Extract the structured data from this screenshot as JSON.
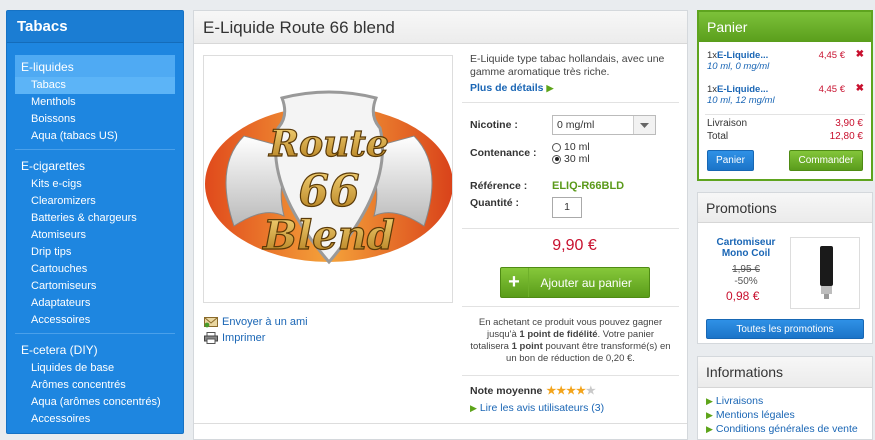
{
  "sidebar": {
    "title": "Tabacs",
    "groups": [
      {
        "label": "E-liquides",
        "items": [
          "Tabacs",
          "Menthols",
          "Boissons",
          "Aqua (tabacs US)"
        ]
      },
      {
        "label": "E-cigarettes",
        "items": [
          "Kits e-cigs",
          "Clearomizers",
          "Batteries & chargeurs",
          "Atomiseurs",
          "Drip tips",
          "Cartouches",
          "Cartomiseurs",
          "Adaptateurs",
          "Accessoires"
        ]
      },
      {
        "label": "E-cetera (DIY)",
        "items": [
          "Liquides de base",
          "Arômes concentrés",
          "Aqua (arômes concentrés)",
          "Accessoires"
        ]
      }
    ]
  },
  "product": {
    "title": "E-Liquide Route 66 blend",
    "image_text": {
      "top": "Route",
      "mid": "66",
      "bottom": "Blend"
    },
    "description": "E-Liquide type tabac hollandais, avec une gamme aromatique très riche.",
    "more_details": "Plus de détails",
    "nicotine_label": "Nicotine :",
    "nicotine_value": "0 mg/ml",
    "contenance_label": "Contenance :",
    "contenance_options": [
      "10 ml",
      "30 ml"
    ],
    "reference_label": "Référence :",
    "reference_value": "ELIQ-R66BLD",
    "quantity_label": "Quantité :",
    "quantity_value": "1",
    "price": "9,90 €",
    "add_to_cart": "Ajouter au panier",
    "loyalty_pre": "En achetant ce produit vous pouvez gagner jusqu'à",
    "loyalty_points1": "1 point de fidélité",
    "loyalty_mid": ". Votre panier totalisera",
    "loyalty_points2": "1 point",
    "loyalty_post": "pouvant être transformé(s) en un bon de réduction de 0,20 €.",
    "rating_label": "Note moyenne",
    "rating": 4,
    "rating_max": 5,
    "reviews_link": "Lire les avis utilisateurs (3)",
    "send_friend": "Envoyer à un ami",
    "print": "Imprimer"
  },
  "cart": {
    "title": "Panier",
    "items": [
      {
        "qty": "1x",
        "name": "E-Liquide...",
        "variant": "10 ml, 0 mg/ml",
        "price": "4,45 €"
      },
      {
        "qty": "1x",
        "name": "E-Liquide...",
        "variant": "10 ml, 12 mg/ml",
        "price": "4,45 €"
      }
    ],
    "shipping_label": "Livraison",
    "shipping_value": "3,90 €",
    "total_label": "Total",
    "total_value": "12,80 €",
    "cart_button": "Panier",
    "order_button": "Commander"
  },
  "promotions": {
    "title": "Promotions",
    "product_name": "Cartomiseur Mono Coil",
    "old_price": "1,95 €",
    "discount": "-50%",
    "new_price": "0,98 €",
    "all_button": "Toutes les promotions"
  },
  "informations": {
    "title": "Informations",
    "links": [
      "Livraisons",
      "Mentions légales",
      "Conditions générales de vente"
    ]
  }
}
